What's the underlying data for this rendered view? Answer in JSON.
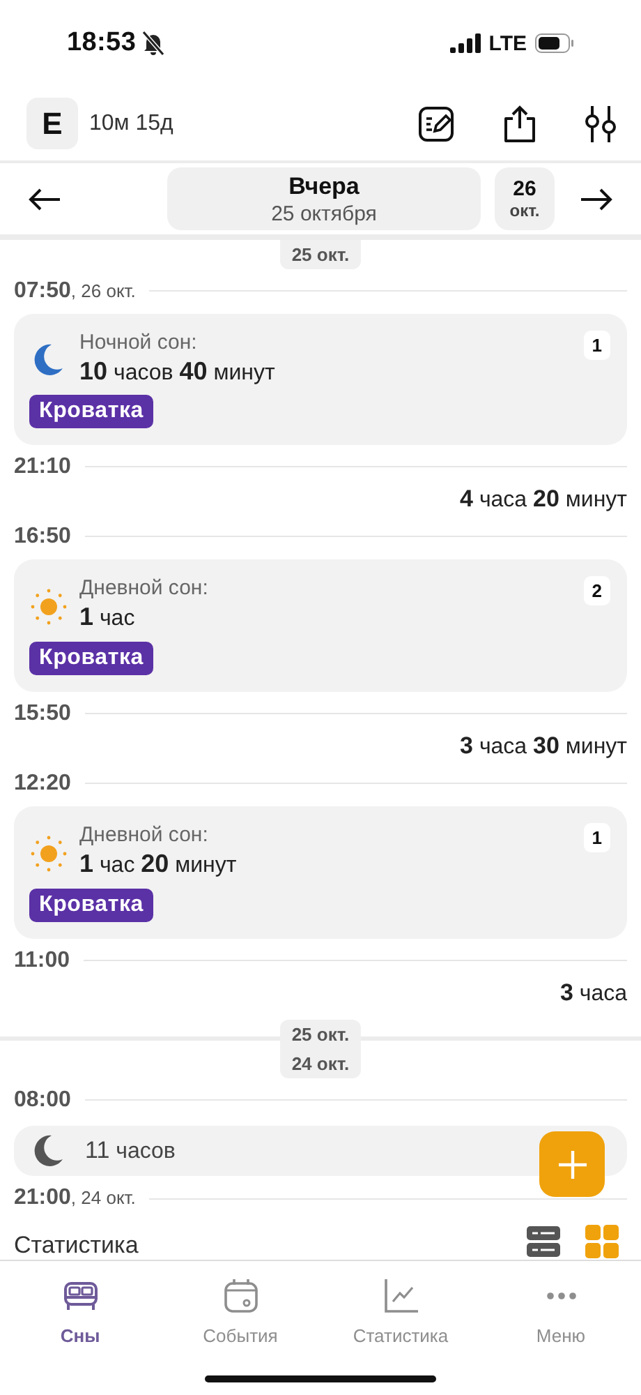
{
  "status_bar": {
    "time": "18:53",
    "network": "LTE"
  },
  "header": {
    "avatar": "E",
    "age": "10м 15д"
  },
  "date_nav": {
    "title": "Вчера",
    "subtitle": "25 октября",
    "next_day": "26",
    "next_month": "окт."
  },
  "timeline": [
    {
      "kind": "date_chip",
      "labels": [
        "25 окт."
      ]
    },
    {
      "kind": "time",
      "time": "07:50",
      "date": ", 26 окт."
    },
    {
      "kind": "night_sleep",
      "label": "Ночной сон:",
      "duration": "**10** часов **40** минут",
      "tag": "Кроватка",
      "count": "1"
    },
    {
      "kind": "time",
      "time": "21:10"
    },
    {
      "kind": "awake",
      "duration": "**4** часа **20** минут"
    },
    {
      "kind": "time",
      "time": "16:50"
    },
    {
      "kind": "day_sleep",
      "label": "Дневной сон:",
      "duration": "**1** час",
      "tag": "Кроватка",
      "count": "2"
    },
    {
      "kind": "time",
      "time": "15:50"
    },
    {
      "kind": "awake",
      "duration": "**3** часа **30** минут"
    },
    {
      "kind": "time",
      "time": "12:20"
    },
    {
      "kind": "day_sleep",
      "label": "Дневной сон:",
      "duration": "**1** час **20** минут",
      "tag": "Кроватка",
      "count": "1"
    },
    {
      "kind": "time",
      "time": "11:00"
    },
    {
      "kind": "awake",
      "duration": "**3** часа"
    },
    {
      "kind": "date_chip",
      "labels": [
        "25 окт.",
        "24 окт."
      ]
    },
    {
      "kind": "time",
      "time": "08:00"
    },
    {
      "kind": "summary",
      "duration": "**11** часов"
    },
    {
      "kind": "time",
      "time": "21:00",
      "date": ", 24 окт."
    },
    {
      "kind": "section",
      "title": "Статистика"
    }
  ],
  "views": [
    {
      "kind": "list",
      "selected": false
    },
    {
      "kind": "grid",
      "selected": true
    }
  ],
  "tabs": [
    {
      "label": "Сны",
      "selected": true
    },
    {
      "label": "События",
      "selected": false
    },
    {
      "label": "Статистика",
      "selected": false
    },
    {
      "label": "Меню",
      "selected": false
    }
  ]
}
